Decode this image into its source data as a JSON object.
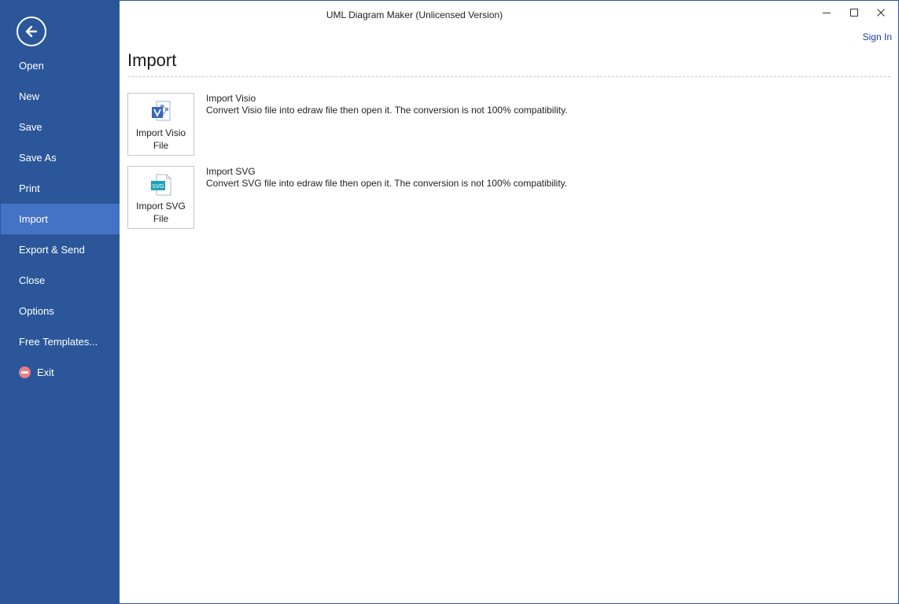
{
  "window": {
    "title": "UML Diagram Maker (Unlicensed Version)",
    "sign_in": "Sign In"
  },
  "sidebar": {
    "back_icon": "back-arrow-icon",
    "items": [
      {
        "label": "Open"
      },
      {
        "label": "New"
      },
      {
        "label": "Save"
      },
      {
        "label": "Save As"
      },
      {
        "label": "Print"
      },
      {
        "label": "Import",
        "active": true
      },
      {
        "label": "Export & Send"
      },
      {
        "label": "Close"
      },
      {
        "label": "Options"
      },
      {
        "label": "Free Templates..."
      },
      {
        "label": "Exit",
        "icon": "exit-icon"
      }
    ]
  },
  "main": {
    "title": "Import",
    "options": [
      {
        "button_label": "Import Visio File",
        "icon": "visio-file-icon",
        "heading": "Import Visio",
        "description": "Convert Visio file into edraw file then open it. The conversion is not 100% compatibility."
      },
      {
        "button_label": "Import SVG File",
        "icon": "svg-file-icon",
        "heading": "Import SVG",
        "description": "Convert SVG file into edraw file then open it. The conversion is not 100% compatibility."
      }
    ]
  },
  "colors": {
    "sidebar": "#2b579a",
    "sidebar_active": "#4472c4",
    "link": "#1f3f9e"
  }
}
